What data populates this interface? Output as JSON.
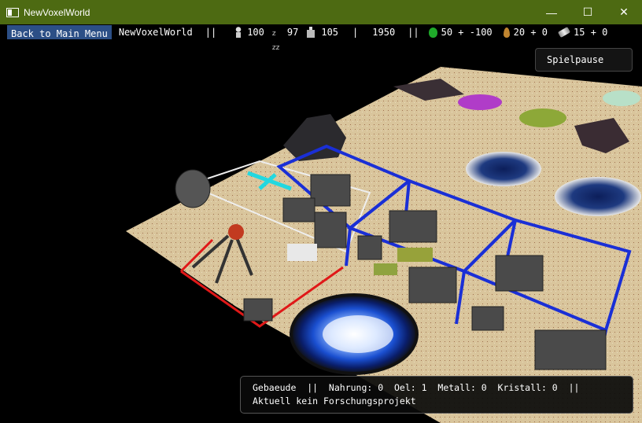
{
  "window": {
    "title": "NewVoxelWorld",
    "controls": {
      "minimize": "—",
      "maximize": "☐",
      "close": "✕"
    }
  },
  "hud": {
    "back_label": "Back to Main Menu",
    "world_name": "NewVoxelWorld",
    "sep": "||",
    "population": "100",
    "sleep": "97",
    "buildings": "105",
    "year_sep": "|",
    "year": "1950",
    "food": "50 + -100",
    "oil": "20 + 0",
    "metal": "15 + 0"
  },
  "pause_label": "Spielpause",
  "info": {
    "line1": "Gebaeude  ||  Nahrung: 0  Oel: 1  Metall: 0  Kristall: 0  ||",
    "line2": "Aktuell kein Forschungsprojekt"
  },
  "colors": {
    "titlebar": "#4d6a12",
    "back_button": "#2c4f86",
    "terrain_sand": "#d8c49a",
    "zone_blue": "#1a2fd6",
    "zone_red": "#e01818"
  }
}
